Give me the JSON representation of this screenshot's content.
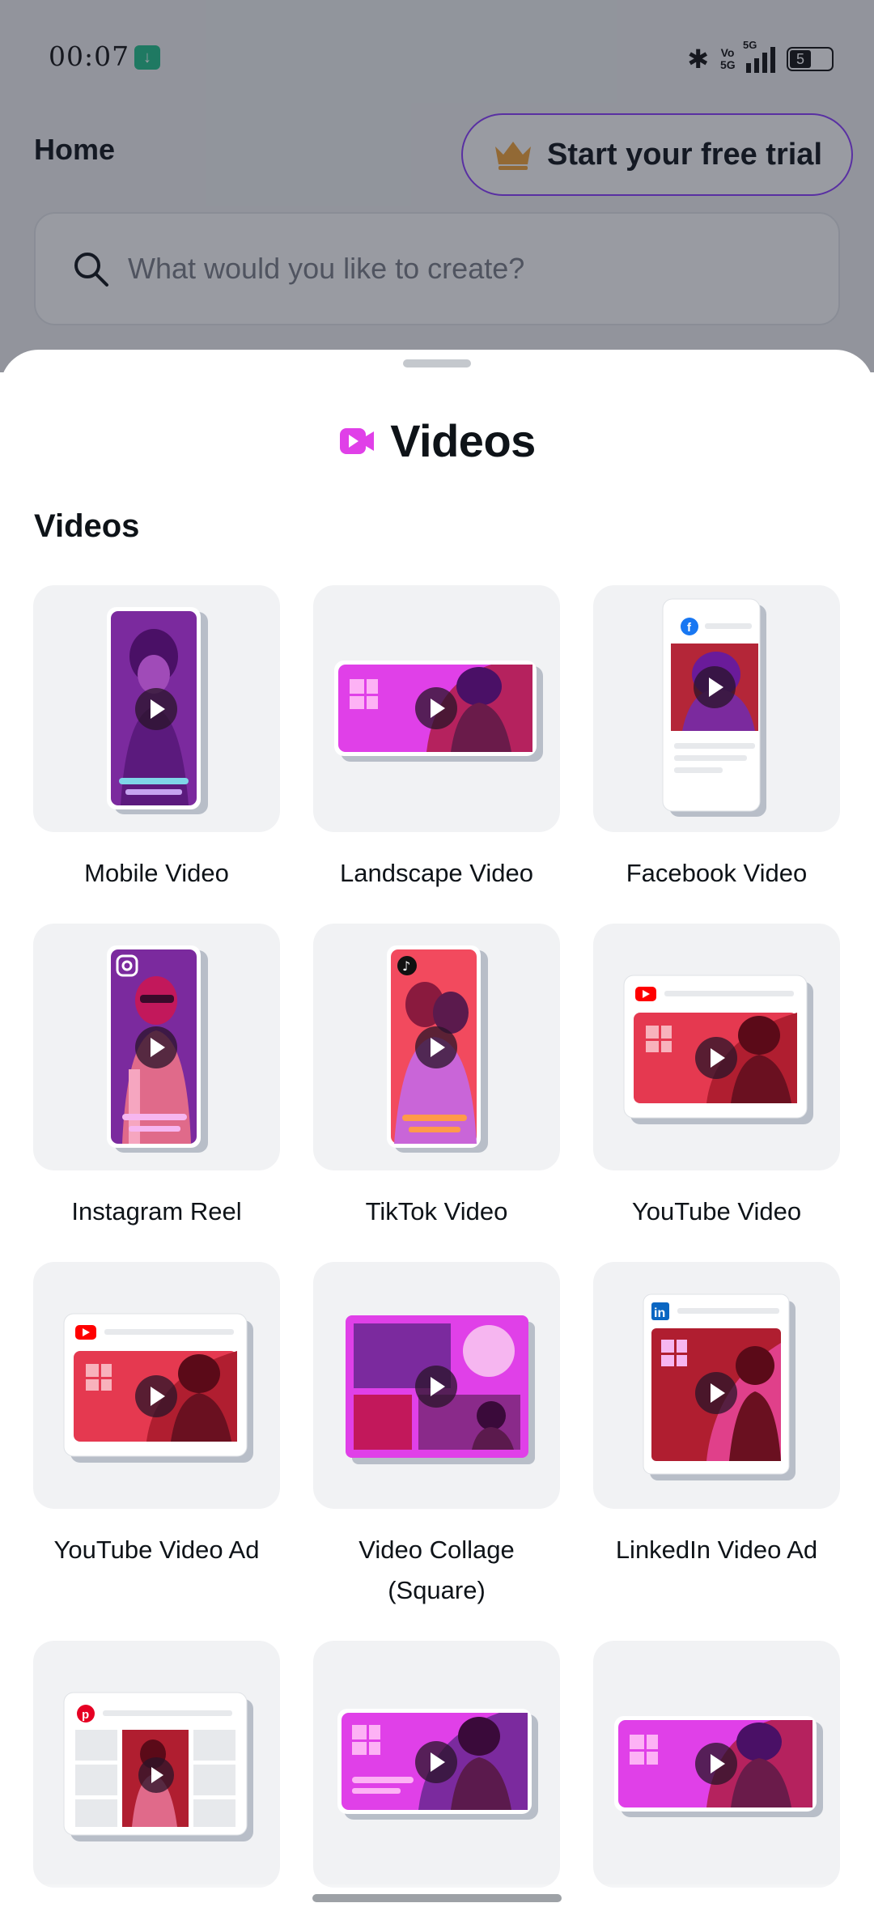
{
  "status_bar": {
    "time": "00:07",
    "network": "5G",
    "battery": "5"
  },
  "header": {
    "title": "Home",
    "trial_button": "Start your free trial"
  },
  "search": {
    "placeholder": "What would you like to create?"
  },
  "sheet": {
    "title": "Videos",
    "section": "Videos",
    "items": [
      {
        "label": "Mobile Video",
        "icon": "mobile-video-thumbnail"
      },
      {
        "label": "Landscape Video",
        "icon": "landscape-video-thumbnail"
      },
      {
        "label": "Facebook Video",
        "icon": "facebook-video-thumbnail"
      },
      {
        "label": "Instagram Reel",
        "icon": "instagram-reel-thumbnail"
      },
      {
        "label": "TikTok Video",
        "icon": "tiktok-video-thumbnail"
      },
      {
        "label": "YouTube Video",
        "icon": "youtube-video-thumbnail"
      },
      {
        "label": "YouTube Video Ad",
        "icon": "youtube-video-ad-thumbnail"
      },
      {
        "label": "Video Collage (Square)",
        "icon": "video-collage-thumbnail"
      },
      {
        "label": "LinkedIn Video Ad",
        "icon": "linkedin-video-ad-thumbnail"
      },
      {
        "label": "",
        "icon": "pinterest-video-thumbnail"
      },
      {
        "label": "",
        "icon": "landscape-video-text-thumbnail"
      },
      {
        "label": "",
        "icon": "landscape-video-alt-thumbnail"
      }
    ]
  },
  "colors": {
    "accent": "#8b3dff",
    "magenta": "#e040e8",
    "purple": "#6a1b9a",
    "red": "#e53950"
  }
}
